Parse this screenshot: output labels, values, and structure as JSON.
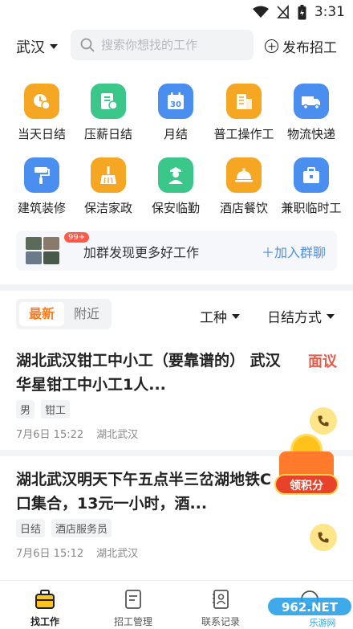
{
  "status_bar": {
    "time": "3:31"
  },
  "top_bar": {
    "city": "武汉",
    "search_placeholder": "搜索你想找的工作",
    "post_label": "发布招工"
  },
  "categories": [
    {
      "label": "当天日结",
      "icon": "clock-coin-icon",
      "color": "#f5a623"
    },
    {
      "label": "压薪日结",
      "icon": "pay-document-icon",
      "color": "#3cc78a"
    },
    {
      "label": "月结",
      "icon": "calendar-30-icon",
      "color": "#4a8ef0"
    },
    {
      "label": "普工操作工",
      "icon": "building-icon",
      "color": "#f5a623"
    },
    {
      "label": "物流快递",
      "icon": "truck-icon",
      "color": "#4a8ef0"
    },
    {
      "label": "建筑装修",
      "icon": "paint-roller-icon",
      "color": "#4a8ef0"
    },
    {
      "label": "保洁家政",
      "icon": "broom-icon",
      "color": "#f5a623"
    },
    {
      "label": "保安临勤",
      "icon": "guard-icon",
      "color": "#3cc78a"
    },
    {
      "label": "酒店餐饮",
      "icon": "cloche-icon",
      "color": "#f5a623"
    },
    {
      "label": "兼职临时工",
      "icon": "briefcase-icon",
      "color": "#4a8ef0"
    }
  ],
  "group_banner": {
    "badge": "99+",
    "text": "加群发现更多好工作",
    "join_label": "加入群聊"
  },
  "filter": {
    "tabs": [
      "最新",
      "附近"
    ],
    "work_type": "工种",
    "settlement": "日结方式"
  },
  "jobs": [
    {
      "title": "湖北武汉钳工中小工（要靠谱的） 武汉华星钳工中小工1人...",
      "salary": "面议",
      "tags": [
        "男",
        "钳工"
      ],
      "time": "7月6日 15:22",
      "location": "湖北武汉"
    },
    {
      "title": "湖北武汉明天下午五点半三岔湖地铁C口集合，13元一小时，酒...",
      "salary": "",
      "tags": [
        "日结",
        "酒店服务员"
      ],
      "time": "7月6日 15:12",
      "location": "湖北武汉"
    }
  ],
  "points_widget": {
    "label": "领积分"
  },
  "bottom_nav": [
    {
      "label": "找工作",
      "icon": "briefcase-icon",
      "active": true
    },
    {
      "label": "招工管理",
      "icon": "document-icon",
      "active": false
    },
    {
      "label": "联系记录",
      "icon": "contacts-icon",
      "active": false
    },
    {
      "label": "",
      "icon": "profile-icon",
      "active": false
    }
  ],
  "watermark": {
    "text": "962.NET",
    "subtext": "乐游网"
  }
}
